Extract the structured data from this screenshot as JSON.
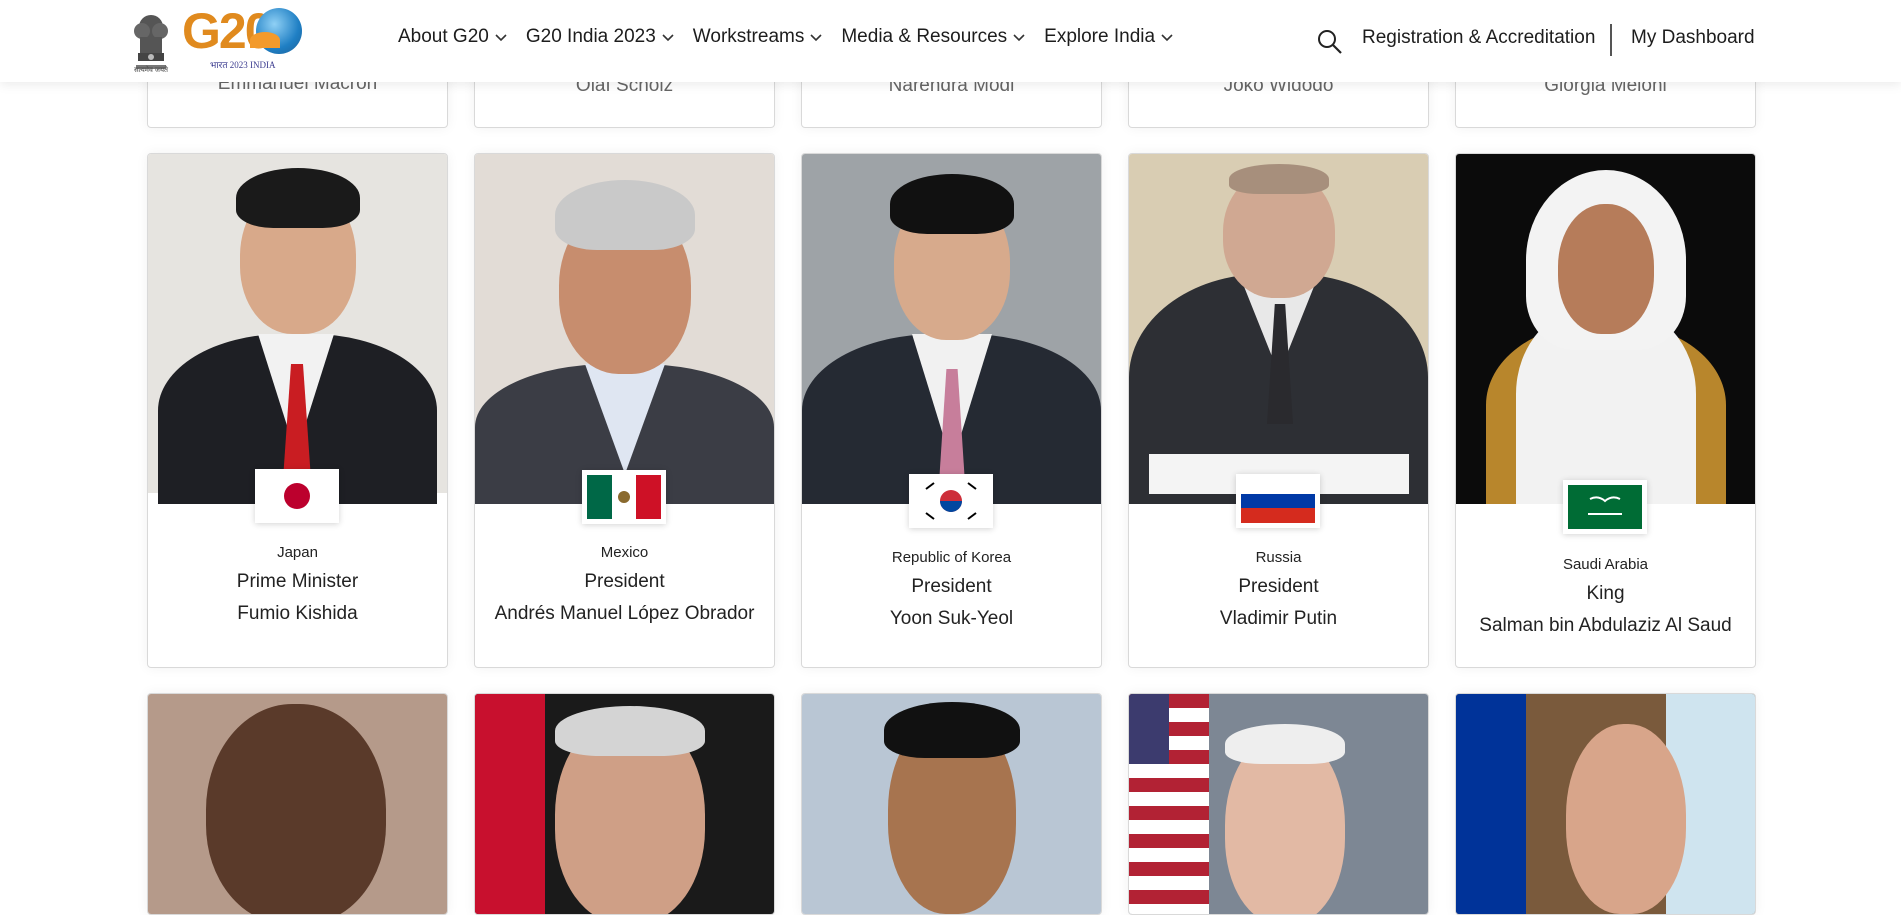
{
  "header": {
    "nav": [
      {
        "label": "About G20"
      },
      {
        "label": "G20 India 2023"
      },
      {
        "label": "Workstreams"
      },
      {
        "label": "Media & Resources"
      },
      {
        "label": "Explore India"
      }
    ],
    "registration_label": "Registration & Accreditation",
    "dashboard_label": "My Dashboard",
    "logo_text": "G20",
    "logo_tagline": "भारत 2023 INDIA",
    "emblem_caption": "सत्यमेव जयते"
  },
  "top_row_names": [
    "Emmanuel Macron",
    "Olaf Scholz",
    "Narendra Modi",
    "Joko Widodo",
    "Giorgia Meloni"
  ],
  "leaders": [
    {
      "country": "Japan",
      "role": "Prime Minister",
      "name": "Fumio Kishida"
    },
    {
      "country": "Mexico",
      "role": "President",
      "name": "Andrés Manuel López Obrador"
    },
    {
      "country": "Republic of Korea",
      "role": "President",
      "name": "Yoon Suk-Yeol"
    },
    {
      "country": "Russia",
      "role": "President",
      "name": "Vladimir Putin"
    },
    {
      "country": "Saudi Arabia",
      "role": "King",
      "name": "Salman bin Abdulaziz Al Saud"
    }
  ],
  "icons": {
    "search": "search-icon",
    "chevron": "chevron-down-icon"
  },
  "colors": {
    "logo_orange": "#e08a1e",
    "text": "#1d1d1d",
    "card_border": "#d9d9d9"
  }
}
